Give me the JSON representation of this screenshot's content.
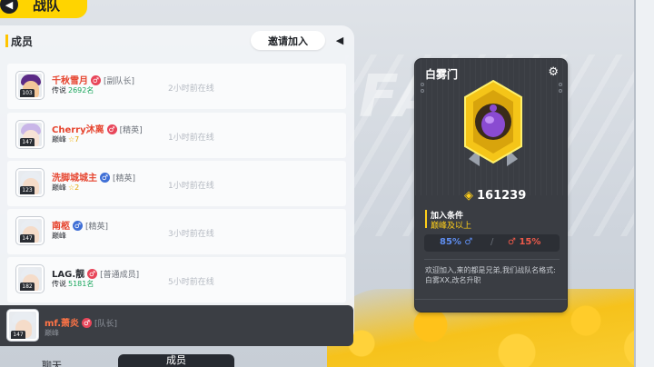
{
  "header": {
    "title": "战队",
    "back_icon": "back-arrow-icon"
  },
  "members": {
    "section_title": "成员",
    "invite_label": "邀请加入",
    "list": [
      {
        "name": "千秋雪月",
        "gender": "female",
        "gender_symbol": "♂",
        "role": "[副队长]",
        "rank": "传说",
        "rank_extra": "2692名",
        "level": "103",
        "online": "2小时前在线"
      },
      {
        "name": "Cherry沐离",
        "gender": "female",
        "gender_symbol": "♂",
        "role": "[精英]",
        "rank": "巅峰",
        "rank_extra": "7",
        "level": "147",
        "online": "1小时前在线"
      },
      {
        "name": "洗脚城城主",
        "gender": "male",
        "gender_symbol": "♂",
        "role": "[精英]",
        "rank": "巅峰",
        "rank_extra": "2",
        "level": "123",
        "online": "1小时前在线"
      },
      {
        "name": "南柩",
        "gender": "male",
        "gender_symbol": "♂",
        "role": "[精英]",
        "rank": "巅峰",
        "rank_extra": "",
        "level": "147",
        "online": "3小时前在线"
      },
      {
        "name": "LAG.靓",
        "gender": "female",
        "gender_symbol": "♂",
        "role": "[普通成员]",
        "rank": "传说",
        "rank_extra": "5181名",
        "level": "182",
        "online": "5小时前在线"
      }
    ],
    "leader": {
      "name": "mf.萧炎",
      "gender": "female",
      "gender_symbol": "♂",
      "role": "[队长]",
      "rank": "巅峰",
      "level": "147"
    }
  },
  "bottom_tabs": {
    "prev": "聊天",
    "active": "成员"
  },
  "team_card": {
    "name": "白雾门",
    "score": "161239",
    "condition_title": "加入条件",
    "condition_value": "巅峰及以上",
    "male_ratio": "85%",
    "male_symbol": "♂",
    "separator": "/",
    "female_symbol": "♂",
    "female_ratio": "15%",
    "description": "欢迎加入,来的都是兄弟,我们战队名格式:白雾XX,改名升职"
  },
  "colors": {
    "accent": "#ffd400",
    "male": "#3f6fd6",
    "female": "#e8465a",
    "card_bg": "#3a3d43"
  }
}
